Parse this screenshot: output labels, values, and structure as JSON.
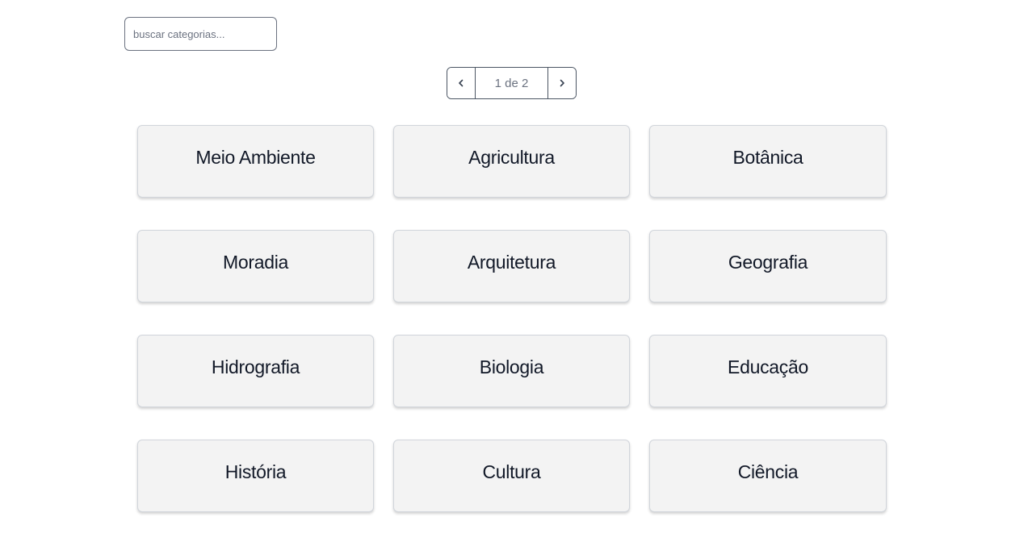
{
  "search": {
    "placeholder": "buscar categorias...",
    "value": ""
  },
  "pagination": {
    "label": "1 de 2",
    "prev_icon": "chevron-left-icon",
    "next_icon": "chevron-right-icon"
  },
  "categories": [
    "Meio Ambiente",
    "Agricultura",
    "Botânica",
    "Moradia",
    "Arquitetura",
    "Geografia",
    "Hidrografia",
    "Biologia",
    "Educação",
    "História",
    "Cultura",
    "Ciência"
  ],
  "colors": {
    "card_background": "#f3f3f3",
    "text": "#111827",
    "border": "#4b5563"
  }
}
